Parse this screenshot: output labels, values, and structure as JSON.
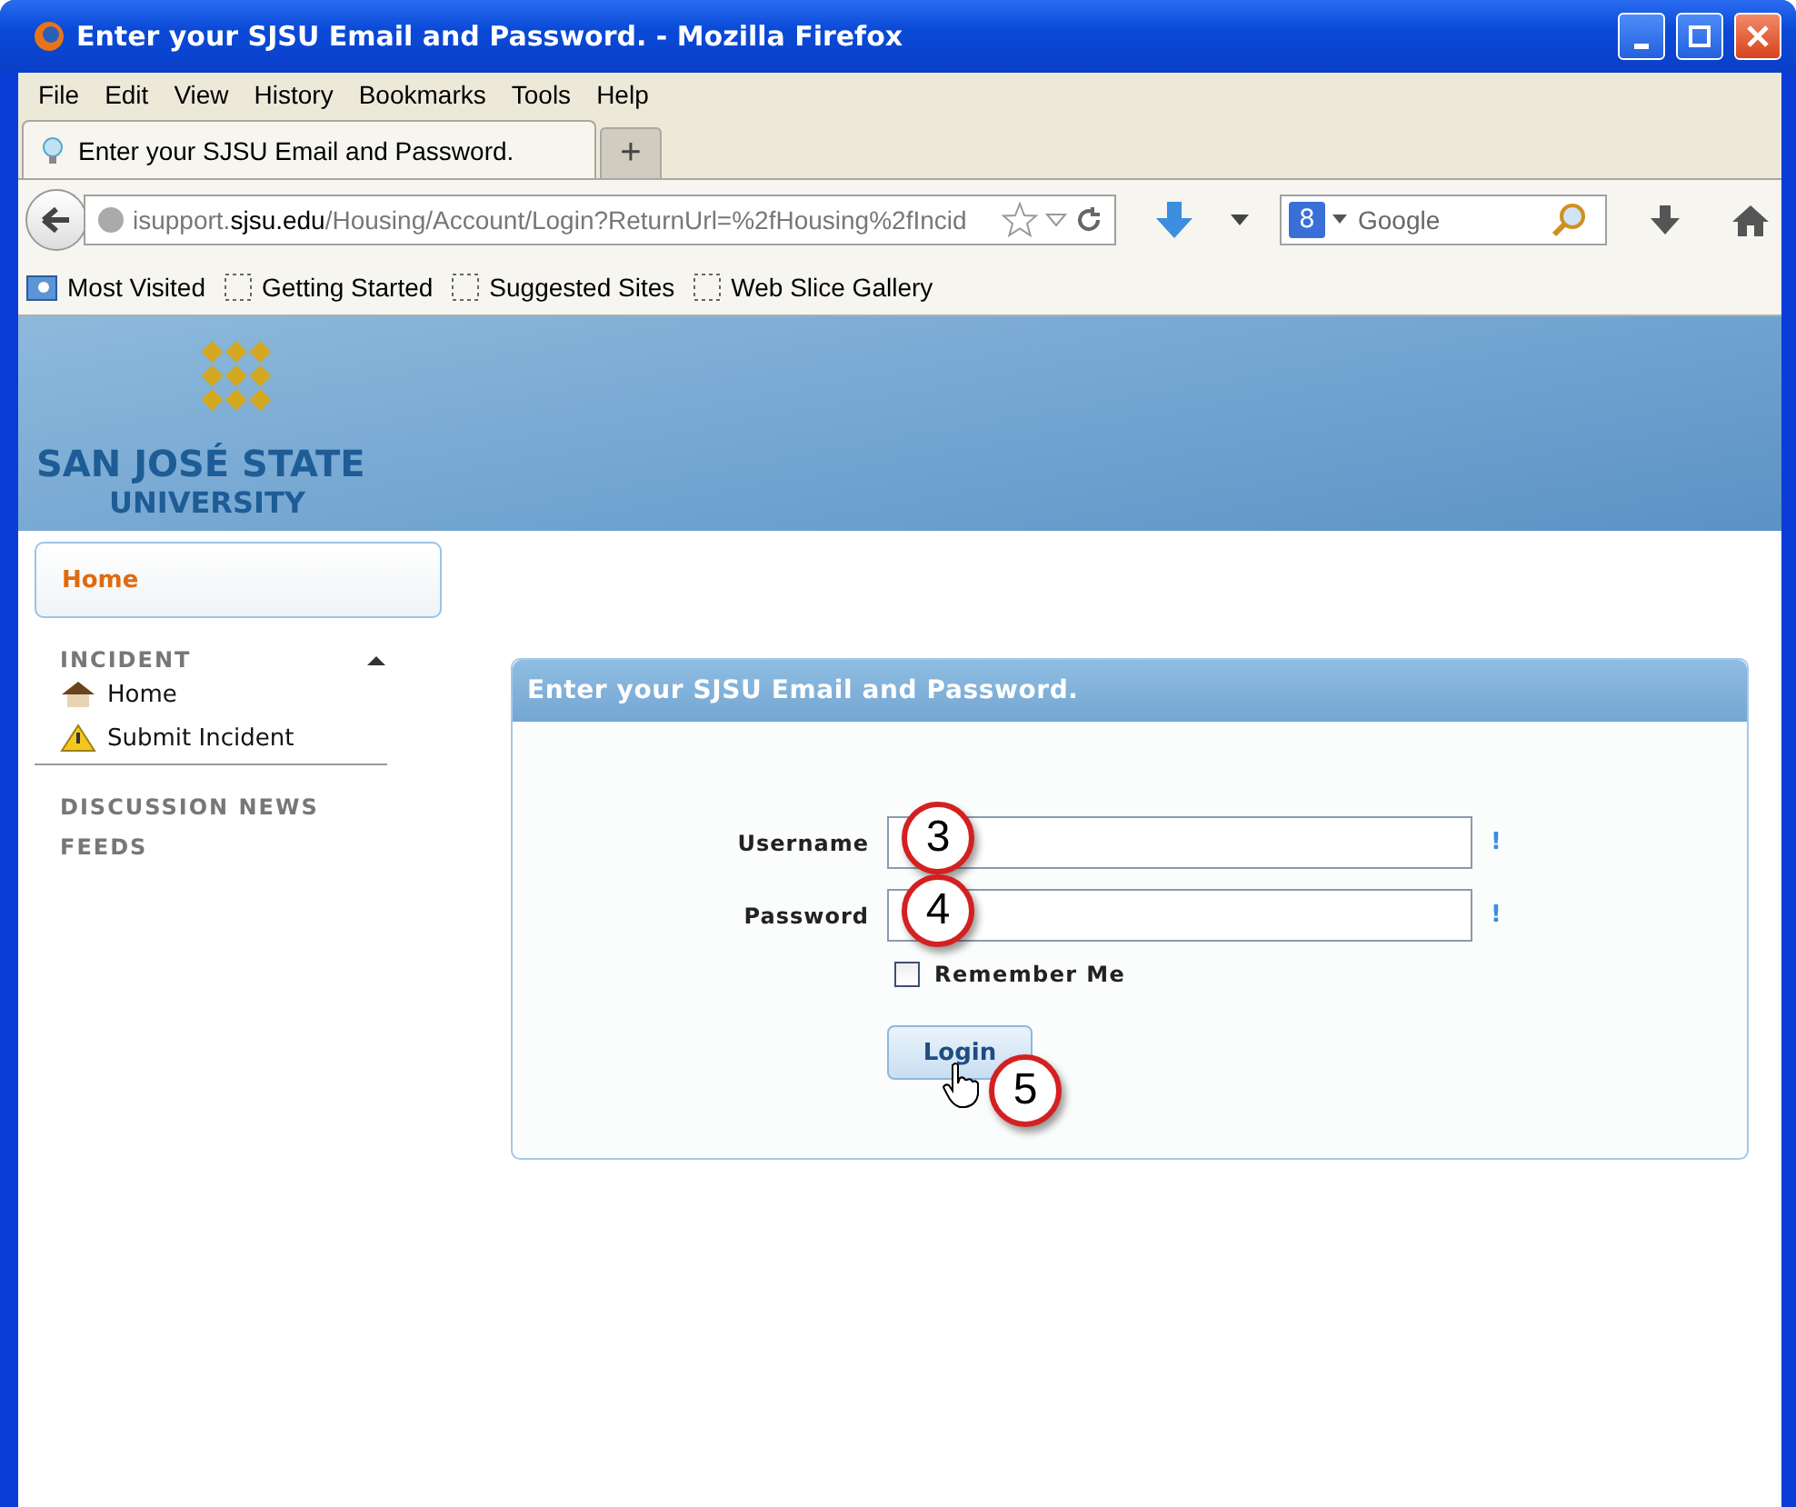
{
  "window": {
    "title": "Enter your SJSU Email and Password. - Mozilla Firefox"
  },
  "menu": [
    "File",
    "Edit",
    "View",
    "History",
    "Bookmarks",
    "Tools",
    "Help"
  ],
  "tabs": [
    {
      "label": "Enter your SJSU Email and Password.",
      "selected": true
    }
  ],
  "new_tab": "+",
  "address_bar": {
    "host_prefix": "isupport.",
    "host": "sjsu.edu",
    "path": "/Housing/Account/Login?ReturnUrl=%2fHousing%2fIncid"
  },
  "search": {
    "engine_badge": "8",
    "placeholder": "Google"
  },
  "bookmarks": [
    "Most Visited",
    "Getting Started",
    "Suggested Sites",
    "Web Slice Gallery"
  ],
  "site": {
    "name_line1": "SAN JOSÉ STATE",
    "name_line2": "UNIVERSITY"
  },
  "sidebar": {
    "top_item": {
      "label": "Home",
      "selected": true
    },
    "sections": [
      {
        "title": "INCIDENT",
        "expanded": true,
        "items": [
          {
            "label": "Home",
            "kind": "house"
          },
          {
            "label": "Submit Incident",
            "kind": "warning"
          }
        ]
      },
      {
        "title": "DISCUSSION NEWS"
      },
      {
        "title": "FEEDS"
      }
    ]
  },
  "login_panel": {
    "title": "Enter your SJSU Email and Password.",
    "fields": [
      {
        "label": "Username",
        "required_mark": "!",
        "callout": "3"
      },
      {
        "label": "Password",
        "required_mark": "!",
        "callout": "4"
      }
    ],
    "remember_me": {
      "label": "Remember Me",
      "checked": false
    },
    "login_button": {
      "label": "Login",
      "callout": "5"
    }
  }
}
